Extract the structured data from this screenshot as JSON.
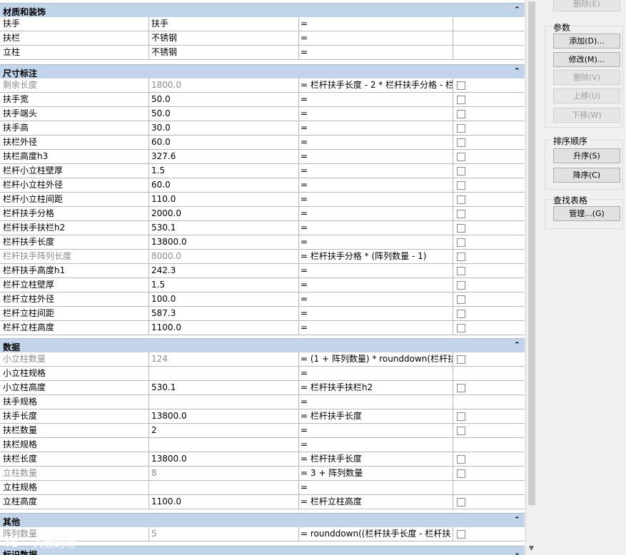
{
  "sections": [
    {
      "title": "材质和装饰",
      "chev": "⌃",
      "rows": [
        {
          "name": "扶手",
          "value": "扶手",
          "formula": "=",
          "check": false,
          "gray": false
        },
        {
          "name": "扶栏",
          "value": "不锈钢",
          "formula": "=",
          "check": false,
          "gray": false
        },
        {
          "name": "立柱",
          "value": "不锈钢",
          "formula": "=",
          "check": false,
          "gray": false
        }
      ]
    },
    {
      "title": "尺寸标注",
      "chev": "⌃",
      "rows": [
        {
          "name": "剩余长度",
          "value": "1800.0",
          "formula": "= 栏杆扶手长度 - 2 * 栏杆扶手分格 - 栏",
          "check": true,
          "gray": true
        },
        {
          "name": "扶手宽",
          "value": "50.0",
          "formula": "=",
          "check": true,
          "gray": false
        },
        {
          "name": "扶手端头",
          "value": "50.0",
          "formula": "=",
          "check": true,
          "gray": false
        },
        {
          "name": "扶手高",
          "value": "30.0",
          "formula": "=",
          "check": true,
          "gray": false
        },
        {
          "name": "扶栏外径",
          "value": "60.0",
          "formula": "=",
          "check": true,
          "gray": false
        },
        {
          "name": "扶栏高度h3",
          "value": "327.6",
          "formula": "=",
          "check": true,
          "gray": false
        },
        {
          "name": "栏杆小立柱壁厚",
          "value": "1.5",
          "formula": "=",
          "check": true,
          "gray": false
        },
        {
          "name": "栏杆小立柱外径",
          "value": "60.0",
          "formula": "=",
          "check": true,
          "gray": false
        },
        {
          "name": "栏杆小立柱间距",
          "value": "110.0",
          "formula": "=",
          "check": true,
          "gray": false
        },
        {
          "name": "栏杆扶手分格",
          "value": "2000.0",
          "formula": "=",
          "check": true,
          "gray": false
        },
        {
          "name": "栏杆扶手扶栏h2",
          "value": "530.1",
          "formula": "=",
          "check": true,
          "gray": false
        },
        {
          "name": "栏杆扶手长度",
          "value": "13800.0",
          "formula": "=",
          "check": true,
          "gray": false
        },
        {
          "name": "栏杆扶手阵列长度",
          "value": "8000.0",
          "formula": "= 栏杆扶手分格 * (阵列数量 - 1)",
          "check": true,
          "gray": true
        },
        {
          "name": "栏杆扶手高度h1",
          "value": "242.3",
          "formula": "=",
          "check": true,
          "gray": false
        },
        {
          "name": "栏杆立柱壁厚",
          "value": "1.5",
          "formula": "=",
          "check": true,
          "gray": false
        },
        {
          "name": "栏杆立柱外径",
          "value": "100.0",
          "formula": "=",
          "check": true,
          "gray": false
        },
        {
          "name": "栏杆立柱间距",
          "value": "587.3",
          "formula": "=",
          "check": true,
          "gray": false
        },
        {
          "name": "栏杆立柱高度",
          "value": "1100.0",
          "formula": "=",
          "check": true,
          "gray": false
        }
      ]
    },
    {
      "title": "数据",
      "chev": "⌃",
      "rows": [
        {
          "name": "小立柱数量",
          "value": "124",
          "formula": "= (1 + 阵列数量) * rounddown(栏杆扶",
          "check": true,
          "gray": true
        },
        {
          "name": "小立柱规格",
          "value": "",
          "formula": "=",
          "check": false,
          "gray": false
        },
        {
          "name": "小立柱高度",
          "value": "530.1",
          "formula": "= 栏杆扶手扶栏h2",
          "check": true,
          "gray": false
        },
        {
          "name": "扶手规格",
          "value": "",
          "formula": "=",
          "check": false,
          "gray": false
        },
        {
          "name": "扶手长度",
          "value": "13800.0",
          "formula": "= 栏杆扶手长度",
          "check": true,
          "gray": false
        },
        {
          "name": "扶栏数量",
          "value": "2",
          "formula": "=",
          "check": true,
          "gray": false
        },
        {
          "name": "扶栏规格",
          "value": "",
          "formula": "=",
          "check": false,
          "gray": false
        },
        {
          "name": "扶栏长度",
          "value": "13800.0",
          "formula": "= 栏杆扶手长度",
          "check": true,
          "gray": false
        },
        {
          "name": "立柱数量",
          "value": "8",
          "formula": "= 3 + 阵列数量",
          "check": true,
          "gray": true
        },
        {
          "name": "立柱规格",
          "value": "",
          "formula": "=",
          "check": false,
          "gray": false
        },
        {
          "name": "立柱高度",
          "value": "1100.0",
          "formula": "= 栏杆立柱高度",
          "check": true,
          "gray": false
        }
      ]
    },
    {
      "title": "其他",
      "chev": "⌃",
      "rows": [
        {
          "name": "阵列数量",
          "value": "5",
          "formula": "= rounddown((栏杆扶手长度 - 栏杆扶",
          "check": true,
          "gray": true
        }
      ]
    },
    {
      "title": "标识数据",
      "chev": "⌄",
      "rows": []
    }
  ],
  "panel": {
    "top_button": "删除(E)",
    "params_label": "参数",
    "param_buttons": [
      "添加(D)...",
      "修改(M)...",
      "删除(V)",
      "上移(U)",
      "下移(W)"
    ],
    "sort_label": "排序顺序",
    "sort_buttons": [
      "升序(S)",
      "降序(C)"
    ],
    "lookup_label": "查找表格",
    "lookup_button": "管理...(G)"
  },
  "watermark": "IC 一人数跨境"
}
